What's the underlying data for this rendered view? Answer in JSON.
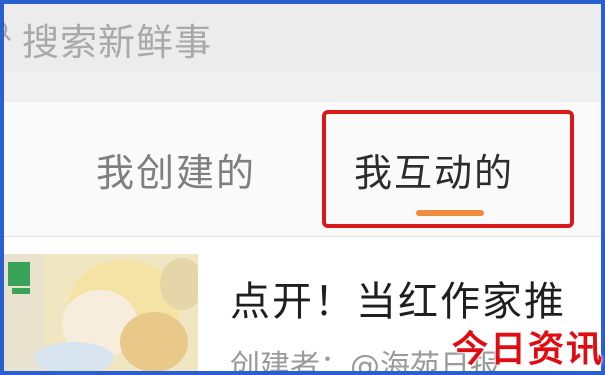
{
  "search": {
    "placeholder": "搜索新鲜事",
    "icon": "search-icon"
  },
  "tabs": [
    {
      "label": "我创建的",
      "active": false
    },
    {
      "label": "我互动的",
      "active": true
    }
  ],
  "colors": {
    "highlight": "#d7191b",
    "active_underline": "#f08a3c",
    "watermark": "#e00c12"
  },
  "card": {
    "title": "点开！当红作家推",
    "meta": "创建者：@海苑日报"
  },
  "watermark": {
    "text": "今日资讯"
  }
}
